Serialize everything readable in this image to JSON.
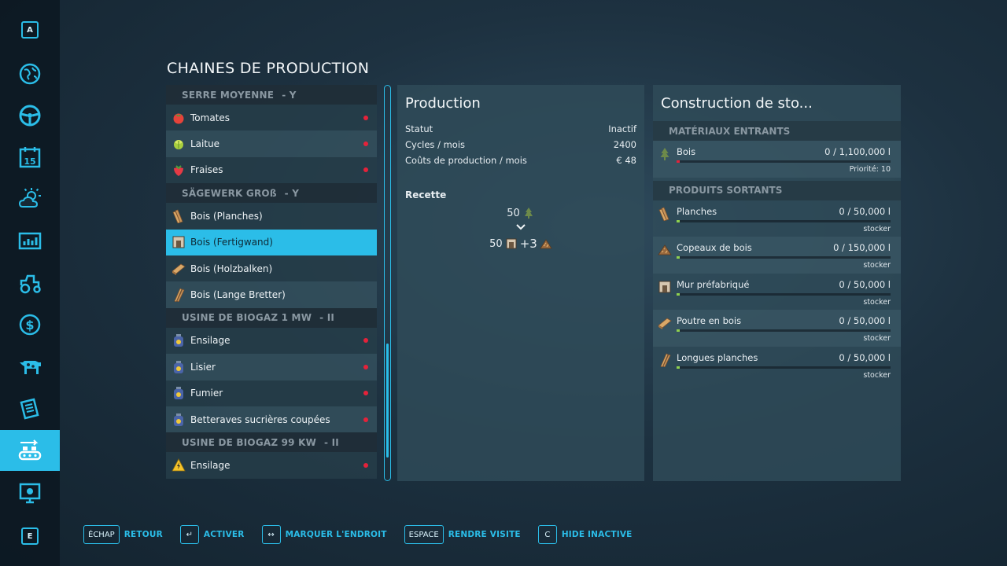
{
  "page_title": "CHAINES DE PRODUCTION",
  "sidebar": {
    "top_key": "A",
    "bottom_key": "E",
    "items": [
      {
        "name": "map-icon"
      },
      {
        "name": "steering-wheel-icon"
      },
      {
        "name": "calendar-icon",
        "day": "15"
      },
      {
        "name": "weather-icon"
      },
      {
        "name": "statistics-icon"
      },
      {
        "name": "tractor-icon"
      },
      {
        "name": "finance-icon"
      },
      {
        "name": "animals-icon"
      },
      {
        "name": "contracts-icon"
      },
      {
        "name": "production-icon"
      },
      {
        "name": "help-icon"
      }
    ]
  },
  "chains": [
    {
      "header": "SERRE MOYENNE",
      "tier": "- Y",
      "items": [
        {
          "label": "Tomates",
          "icon": "tomato-icon",
          "dot": true
        },
        {
          "label": "Laitue",
          "icon": "lettuce-icon",
          "dot": true
        },
        {
          "label": "Fraises",
          "icon": "strawberry-icon",
          "dot": true
        }
      ]
    },
    {
      "header": "SÄGEWERK GROß",
      "tier": "- Y",
      "items": [
        {
          "label": "Bois (Planches)",
          "icon": "planks-icon",
          "dot": false
        },
        {
          "label": "Bois (Fertigwand)",
          "icon": "prefab-wall-icon",
          "dot": false,
          "selected": true
        },
        {
          "label": "Bois (Holzbalken)",
          "icon": "wooden-beam-icon",
          "dot": false
        },
        {
          "label": "Bois (Lange Bretter)",
          "icon": "long-planks-icon",
          "dot": false
        }
      ]
    },
    {
      "header": "USINE DE BIOGAZ 1 MW",
      "tier": "- II",
      "items": [
        {
          "label": "Ensilage",
          "icon": "biogas-bottle-icon",
          "dot": true
        },
        {
          "label": "Lisier",
          "icon": "biogas-bottle-icon",
          "dot": true
        },
        {
          "label": "Fumier",
          "icon": "biogas-bottle-icon",
          "dot": true
        },
        {
          "label": "Betteraves sucrières coupées",
          "icon": "biogas-bottle-icon",
          "dot": true
        }
      ]
    },
    {
      "header": "USINE DE BIOGAZ 99 KW",
      "tier": "- II",
      "items": [
        {
          "label": "Ensilage",
          "icon": "electricity-warning-icon",
          "dot": true
        }
      ]
    }
  ],
  "production": {
    "title": "Production",
    "stats": [
      {
        "label": "Statut",
        "value": "Inactif"
      },
      {
        "label": "Cycles / mois",
        "value": "2400"
      },
      {
        "label": "Coûts de production / mois",
        "value": "€ 48"
      }
    ],
    "recipe_title": "Recette",
    "recipe_input": "50",
    "recipe_output_1": "50",
    "recipe_output_2": "+3"
  },
  "storage": {
    "title": "Construction de sto...",
    "inputs_header": "MATÉRIAUX ENTRANTS",
    "inputs": [
      {
        "name": "Bois",
        "qty": "0  / 1,100,000 l",
        "sub": "Priorité: 10",
        "icon": "tree-icon",
        "bar_color": "#e5223a"
      }
    ],
    "outputs_header": "PRODUITS SORTANTS",
    "outputs": [
      {
        "name": "Planches",
        "qty": "0  / 50,000 l",
        "sub": "stocker",
        "icon": "planks-icon",
        "bar_color": "#8fd14f"
      },
      {
        "name": "Copeaux de bois",
        "qty": "0  / 150,000 l",
        "sub": "stocker",
        "icon": "woodchips-icon",
        "bar_color": "#8fd14f"
      },
      {
        "name": "Mur préfabriqué",
        "qty": "0  / 50,000 l",
        "sub": "stocker",
        "icon": "prefab-wall-icon",
        "bar_color": "#8fd14f"
      },
      {
        "name": "Poutre en bois",
        "qty": "0  / 50,000 l",
        "sub": "stocker",
        "icon": "wooden-beam-icon",
        "bar_color": "#8fd14f"
      },
      {
        "name": "Longues planches",
        "qty": "0  / 50,000 l",
        "sub": "stocker",
        "icon": "long-planks-icon",
        "bar_color": "#8fd14f"
      }
    ]
  },
  "footer": [
    {
      "key": "ÉCHAP",
      "label": "RETOUR"
    },
    {
      "key": "↵",
      "label": "ACTIVER"
    },
    {
      "key": "↔",
      "label": "MARQUER L'ENDROIT"
    },
    {
      "key": "ESPACE",
      "label": "RENDRE VISITE"
    },
    {
      "key": "C",
      "label": "HIDE INACTIVE"
    }
  ],
  "colors": {
    "accent": "#2bbde8",
    "status_dot": "#e5223a",
    "fill_ok": "#8fd14f"
  }
}
